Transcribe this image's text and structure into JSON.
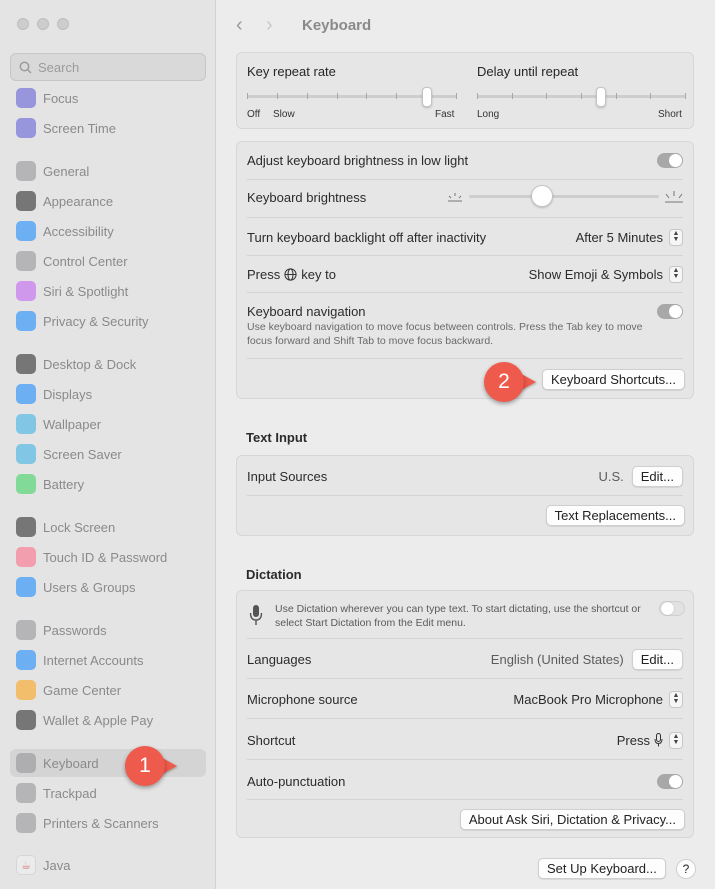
{
  "window": {
    "title": "Keyboard"
  },
  "sidebar": {
    "search_placeholder": "Search",
    "items": [
      {
        "label": "Focus",
        "icon": "moon-icon",
        "color": "#5856d6"
      },
      {
        "label": "Screen Time",
        "icon": "hourglass-icon",
        "color": "#5856d6"
      },
      {
        "label": "General",
        "icon": "gear-icon",
        "color": "#8e8e93"
      },
      {
        "label": "Appearance",
        "icon": "appearance-icon",
        "color": "#1c1c1e"
      },
      {
        "label": "Accessibility",
        "icon": "accessibility-icon",
        "color": "#0a84ff"
      },
      {
        "label": "Control Center",
        "icon": "control-center-icon",
        "color": "#8e8e93"
      },
      {
        "label": "Siri & Spotlight",
        "icon": "siri-icon",
        "color": "#bf5af2"
      },
      {
        "label": "Privacy & Security",
        "icon": "hand-icon",
        "color": "#0a84ff"
      },
      {
        "label": "Desktop & Dock",
        "icon": "dock-icon",
        "color": "#1c1c1e"
      },
      {
        "label": "Displays",
        "icon": "sun-icon",
        "color": "#0a84ff"
      },
      {
        "label": "Wallpaper",
        "icon": "flower-icon",
        "color": "#32ade6"
      },
      {
        "label": "Screen Saver",
        "icon": "screen-saver-icon",
        "color": "#32ade6"
      },
      {
        "label": "Battery",
        "icon": "battery-icon",
        "color": "#30d158"
      },
      {
        "label": "Lock Screen",
        "icon": "lock-icon",
        "color": "#1c1c1e"
      },
      {
        "label": "Touch ID & Password",
        "icon": "fingerprint-icon",
        "color": "#ff6482"
      },
      {
        "label": "Users & Groups",
        "icon": "users-icon",
        "color": "#0a84ff"
      },
      {
        "label": "Passwords",
        "icon": "key-icon",
        "color": "#8e8e93"
      },
      {
        "label": "Internet Accounts",
        "icon": "at-icon",
        "color": "#0a84ff"
      },
      {
        "label": "Game Center",
        "icon": "game-center-icon",
        "color": "#ff9f0a"
      },
      {
        "label": "Wallet & Apple Pay",
        "icon": "wallet-icon",
        "color": "#1c1c1e"
      },
      {
        "label": "Keyboard",
        "icon": "keyboard-icon",
        "color": "#8e8e93",
        "selected": true
      },
      {
        "label": "Trackpad",
        "icon": "trackpad-icon",
        "color": "#8e8e93"
      },
      {
        "label": "Printers & Scanners",
        "icon": "printer-icon",
        "color": "#8e8e93"
      },
      {
        "label": "Java",
        "icon": "java-icon",
        "color": "#f2f2f2"
      }
    ]
  },
  "repeat": {
    "key_repeat_label": "Key repeat rate",
    "key_repeat_off": "Off",
    "key_repeat_slow": "Slow",
    "key_repeat_fast": "Fast",
    "key_repeat_value": 0.875,
    "delay_label": "Delay until repeat",
    "delay_long": "Long",
    "delay_short": "Short",
    "delay_value": 0.6
  },
  "backlight": {
    "adjust_label": "Adjust keyboard brightness in low light",
    "adjust_on": true,
    "brightness_label": "Keyboard brightness",
    "brightness_value": 0.37,
    "inactivity_label": "Turn keyboard backlight off after inactivity",
    "inactivity_value": "After 5 Minutes",
    "press_key_prefix": "Press",
    "press_key_suffix": "key to",
    "press_key_value": "Show Emoji & Symbols",
    "nav_label": "Keyboard navigation",
    "nav_desc": "Use keyboard navigation to move focus between controls. Press the Tab key to move focus forward and Shift Tab to move focus backward.",
    "nav_on": true,
    "shortcuts_button": "Keyboard Shortcuts..."
  },
  "text_input": {
    "title": "Text Input",
    "input_sources_label": "Input Sources",
    "input_sources_value": "U.S.",
    "edit_button": "Edit...",
    "replacements_button": "Text Replacements..."
  },
  "dictation": {
    "title": "Dictation",
    "desc": "Use Dictation wherever you can type text. To start dictating, use the shortcut or select Start Dictation from the Edit menu.",
    "enabled": false,
    "languages_label": "Languages",
    "languages_value": "English (United States)",
    "edit_button": "Edit...",
    "mic_label": "Microphone source",
    "mic_value": "MacBook Pro Microphone",
    "shortcut_label": "Shortcut",
    "shortcut_value": "Press",
    "autopunct_label": "Auto-punctuation",
    "autopunct_on": true,
    "about_button": "About Ask Siri, Dictation & Privacy..."
  },
  "footer": {
    "setup_button": "Set Up Keyboard...",
    "help_button": "?"
  },
  "callouts": {
    "one": "1",
    "two": "2"
  }
}
